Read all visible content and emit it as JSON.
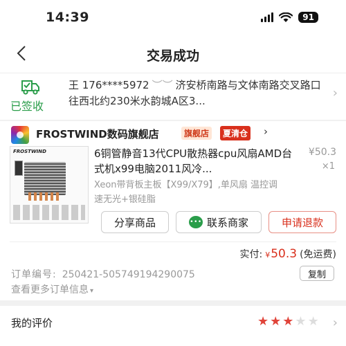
{
  "status_bar": {
    "time": "14:39",
    "battery": "91",
    "icons": [
      "signal-icon",
      "wifi-icon",
      "battery-icon"
    ]
  },
  "nav": {
    "title": "交易成功",
    "back_icon": "chevron-left-icon"
  },
  "address": {
    "status": "已签收",
    "status_color": "#2a9d4a",
    "icon": "delivery-truck-icon",
    "recipient": "王 176****5972",
    "privacy_icon": "eye-closed-icon",
    "address_text": "济安桥南路与文体南路交叉路口往西北约230米水韵城A区3..."
  },
  "shop": {
    "name": "FROSTWIND数码旗舰店",
    "badge_flagship": "旗舰店",
    "badge_sale": "夏清仓",
    "product": {
      "image_brand": "FROSTWIND",
      "title": "6铜管静音13代CPU散热器cpu风扇AMD台式机x99电脑2011风冷...",
      "price": "¥50.3",
      "quantity": "×1",
      "spec": "Xeon带背板主板【X99/X79】,单风扇 温控调速无光+银硅脂"
    },
    "buttons": {
      "share": "分享商品",
      "contact": "联系商家",
      "refund": "申请退款"
    },
    "paid": {
      "label": "实付:",
      "currency": "¥",
      "amount": "50.3",
      "note": "(免运费)"
    }
  },
  "order": {
    "number_label": "订单编号:",
    "number": "250421-505749194290075",
    "copy_label": "复制",
    "more_label": "查看更多订单信息"
  },
  "review": {
    "label": "我的评价",
    "rating": 3,
    "max_rating": 5
  },
  "colors": {
    "accent_red": "#d9301d",
    "success_green": "#2a9d4a"
  }
}
